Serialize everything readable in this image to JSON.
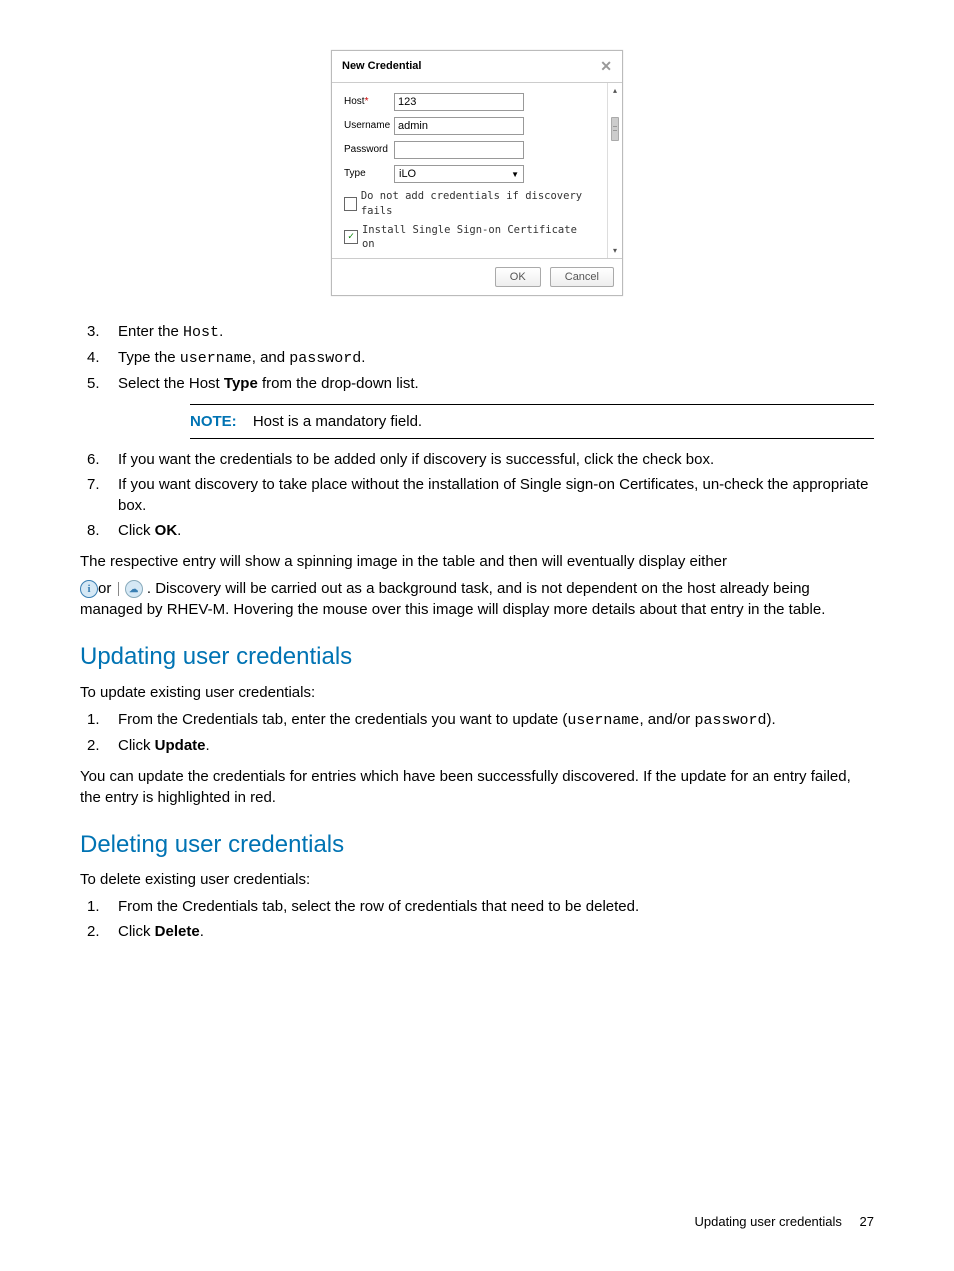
{
  "dialog": {
    "title": "New Credential",
    "fields": {
      "host_label": "Host",
      "host_required": "*",
      "host_value": "123",
      "username_label": "Username",
      "username_value": "admin",
      "password_label": "Password",
      "password_value": "",
      "type_label": "Type",
      "type_value": "iLO"
    },
    "checkbox1_label": "Do not add credentials if discovery fails",
    "checkbox2_label": "Install Single Sign-on Certificate on",
    "ok": "OK",
    "cancel": "Cancel"
  },
  "steps_a": {
    "s3_pre": "Enter the ",
    "s3_code": "Host",
    "s3_post": ".",
    "s4_pre": "Type the ",
    "s4_code1": "username",
    "s4_mid": ", and ",
    "s4_code2": "password",
    "s4_post": ".",
    "s5_pre": "Select the Host ",
    "s5_bold": "Type",
    "s5_post": " from the drop-down list."
  },
  "note": {
    "label": "NOTE:",
    "text": "Host is a mandatory field."
  },
  "steps_b": {
    "s6": "If you want the credentials to be added only if discovery is successful, click the check box.",
    "s7": "If you want discovery to take place without the installation of Single sign-on Certificates, un-check the appropriate box.",
    "s8_pre": "Click ",
    "s8_bold": "OK",
    "s8_post": "."
  },
  "para1": "The respective entry will show a spinning image in the table and then will eventually display either",
  "para2_mid": "or",
  "para2_post": " . Discovery will be carried out as a background task, and is not dependent on the host already being managed by RHEV-M. Hovering the mouse over this image will display more details about that entry in the table.",
  "section_update": {
    "title": "Updating user credentials",
    "intro": "To update existing user credentials:",
    "s1_pre": "From the Credentials tab, enter the credentials you want to update (",
    "s1_code1": "username",
    "s1_mid": ", and/or ",
    "s1_code2": "password",
    "s1_post": ").",
    "s2_pre": "Click ",
    "s2_bold": "Update",
    "s2_post": ".",
    "outro": "You can update the credentials for entries which have been successfully discovered. If the update for an entry failed, the entry is highlighted in red."
  },
  "section_delete": {
    "title": "Deleting user credentials",
    "intro": "To delete existing user credentials:",
    "s1": "From the Credentials tab, select the row of credentials that need to be deleted.",
    "s2_pre": "Click ",
    "s2_bold": "Delete",
    "s2_post": "."
  },
  "footer": {
    "text": "Updating user credentials",
    "page": "27"
  }
}
